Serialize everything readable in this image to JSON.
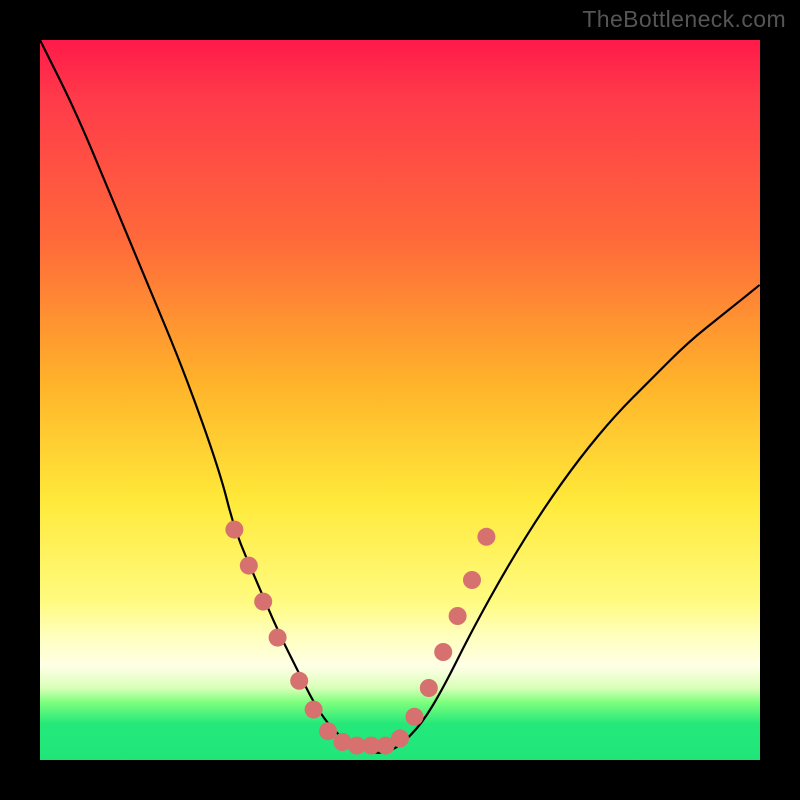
{
  "watermark": "TheBottleneck.com",
  "colors": {
    "background": "#000000",
    "gradient_top": "#ff1a4a",
    "gradient_mid": "#ffe93a",
    "gradient_bottom": "#20e67a",
    "curve": "#000000",
    "marker_fill": "#d6716f",
    "marker_stroke": "#a24e4c"
  },
  "chart_data": {
    "type": "line",
    "title": "",
    "xlabel": "",
    "ylabel": "",
    "xlim": [
      0,
      100
    ],
    "ylim": [
      0,
      100
    ],
    "note": "Implied scales: x ≈ relative component balance (0–100); y ≈ bottleneck severity %, 0 at bottom (good / green) to 100 at top (bad / red). Values estimated from pixel plot.",
    "series": [
      {
        "name": "bottleneck-curve",
        "x": [
          0,
          5,
          10,
          15,
          20,
          25,
          27,
          30,
          33,
          36,
          38,
          40,
          42,
          44,
          46,
          48,
          50,
          53,
          56,
          60,
          65,
          70,
          75,
          80,
          85,
          90,
          95,
          100
        ],
        "y": [
          100,
          90,
          78,
          66,
          54,
          40,
          32,
          25,
          18,
          12,
          8,
          5,
          3,
          2,
          1,
          1,
          2,
          5,
          10,
          18,
          27,
          35,
          42,
          48,
          53,
          58,
          62,
          66
        ]
      }
    ],
    "markers": {
      "name": "highlighted-points",
      "note": "Salmon circular markers along the curve near the trough",
      "points": [
        {
          "x": 27,
          "y": 32
        },
        {
          "x": 29,
          "y": 27
        },
        {
          "x": 31,
          "y": 22
        },
        {
          "x": 33,
          "y": 17
        },
        {
          "x": 36,
          "y": 11
        },
        {
          "x": 38,
          "y": 7
        },
        {
          "x": 40,
          "y": 4
        },
        {
          "x": 42,
          "y": 2.5
        },
        {
          "x": 44,
          "y": 2
        },
        {
          "x": 46,
          "y": 2
        },
        {
          "x": 48,
          "y": 2
        },
        {
          "x": 50,
          "y": 3
        },
        {
          "x": 52,
          "y": 6
        },
        {
          "x": 54,
          "y": 10
        },
        {
          "x": 56,
          "y": 15
        },
        {
          "x": 58,
          "y": 20
        },
        {
          "x": 60,
          "y": 25
        },
        {
          "x": 62,
          "y": 31
        }
      ]
    }
  }
}
